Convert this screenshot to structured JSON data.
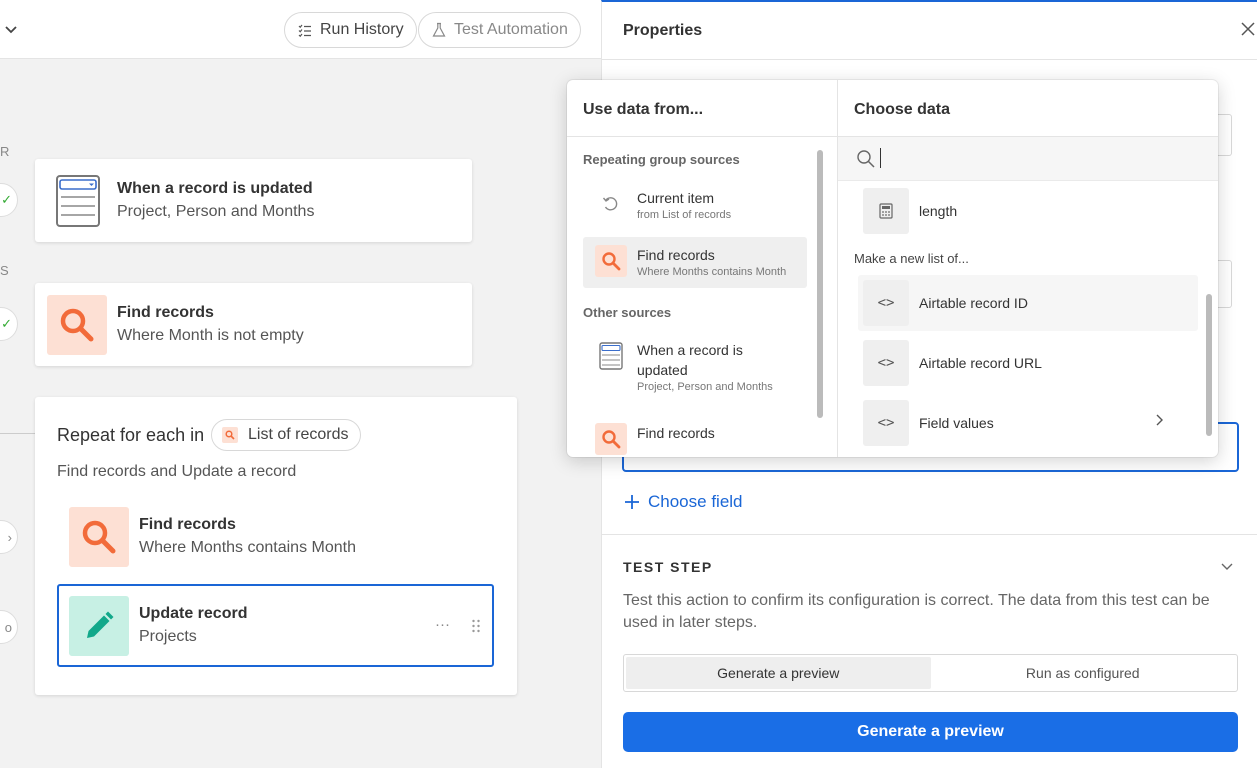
{
  "topbar": {
    "run_history_label": "Run History",
    "test_automation_label": "Test Automation"
  },
  "canvas": {
    "edge_labels": [
      "R",
      "S"
    ],
    "nodes": [
      {
        "title": "When a record is updated",
        "subtitle": "Project, Person and Months",
        "icon": "form-icon"
      },
      {
        "title": "Find records",
        "subtitle": "Where Month is not empty",
        "icon": "search-icon"
      }
    ],
    "repeat": {
      "title": "Repeat for each in",
      "chip_label": "List of records",
      "subtitle": "Find records and Update a record",
      "steps": [
        {
          "title": "Find records",
          "subtitle": "Where Months contains Month",
          "icon": "search-icon"
        },
        {
          "title": "Update record",
          "subtitle": "Projects",
          "icon": "pencil-icon"
        }
      ]
    }
  },
  "panel": {
    "title": "Properties",
    "choose_field_label": "Choose field",
    "test_step": {
      "title": "TEST STEP",
      "description": "Test this action to confirm its configuration is correct. The data from this test can be used in later steps.",
      "tab_preview": "Generate a preview",
      "tab_configured": "Run as configured",
      "button_label": "Generate a preview"
    }
  },
  "popover": {
    "left_title": "Use data from...",
    "right_title": "Choose data",
    "repeating_label": "Repeating group sources",
    "other_label": "Other sources",
    "repeating_sources": [
      {
        "title": "Current item",
        "subtitle": "from List of records"
      },
      {
        "title": "Find records",
        "subtitle": "Where Months contains Month"
      }
    ],
    "other_sources": [
      {
        "title": "When a record is updated",
        "subtitle": "Project, Person and Months"
      },
      {
        "title": "Find records",
        "subtitle": ""
      }
    ],
    "length_label": "length",
    "make_list_label": "Make a new list of...",
    "data_items": [
      {
        "label": "Airtable record ID"
      },
      {
        "label": "Airtable record URL"
      },
      {
        "label": "Field values"
      }
    ],
    "code_glyph": "<>"
  },
  "colors": {
    "accent_blue": "#1a6ee6",
    "orange_icon": "#f26b3a",
    "orange_bg": "#fde0d4",
    "teal_icon": "#12a88a",
    "teal_bg": "#c7f0e4"
  }
}
